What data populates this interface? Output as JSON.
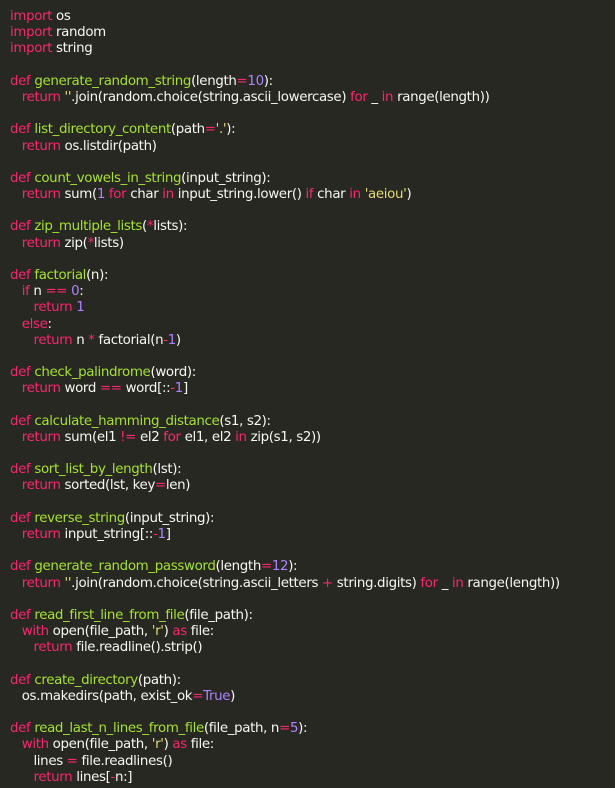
{
  "editor": {
    "lines": [
      [
        [
          "kw",
          "import"
        ],
        [
          "plain",
          " os"
        ]
      ],
      [
        [
          "kw",
          "import"
        ],
        [
          "plain",
          " random"
        ]
      ],
      [
        [
          "kw",
          "import"
        ],
        [
          "plain",
          " string"
        ]
      ],
      [],
      [
        [
          "kw",
          "def"
        ],
        [
          "plain",
          " "
        ],
        [
          "fn",
          "generate_random_string"
        ],
        [
          "plain",
          "(length"
        ],
        [
          "kw",
          "="
        ],
        [
          "num",
          "10"
        ],
        [
          "plain",
          "):"
        ]
      ],
      [
        [
          "plain",
          "   "
        ],
        [
          "kw",
          "return"
        ],
        [
          "plain",
          " "
        ],
        [
          "str",
          "''"
        ],
        [
          "plain",
          ".join(random.choice(string.ascii_lowercase) "
        ],
        [
          "kw",
          "for"
        ],
        [
          "plain",
          " _ "
        ],
        [
          "kw",
          "in"
        ],
        [
          "plain",
          " range(length))"
        ]
      ],
      [],
      [
        [
          "kw",
          "def"
        ],
        [
          "plain",
          " "
        ],
        [
          "fn",
          "list_directory_content"
        ],
        [
          "plain",
          "(path"
        ],
        [
          "kw",
          "="
        ],
        [
          "str",
          "'.'"
        ],
        [
          "plain",
          "):"
        ]
      ],
      [
        [
          "plain",
          "   "
        ],
        [
          "kw",
          "return"
        ],
        [
          "plain",
          " os.listdir(path)"
        ]
      ],
      [],
      [
        [
          "kw",
          "def"
        ],
        [
          "plain",
          " "
        ],
        [
          "fn",
          "count_vowels_in_string"
        ],
        [
          "plain",
          "(input_string):"
        ]
      ],
      [
        [
          "plain",
          "   "
        ],
        [
          "kw",
          "return"
        ],
        [
          "plain",
          " sum("
        ],
        [
          "num",
          "1"
        ],
        [
          "plain",
          " "
        ],
        [
          "kw",
          "for"
        ],
        [
          "plain",
          " char "
        ],
        [
          "kw",
          "in"
        ],
        [
          "plain",
          " input_string.lower() "
        ],
        [
          "kw",
          "if"
        ],
        [
          "plain",
          " char "
        ],
        [
          "kw",
          "in"
        ],
        [
          "plain",
          " "
        ],
        [
          "str",
          "'aeiou'"
        ],
        [
          "plain",
          ")"
        ]
      ],
      [],
      [
        [
          "kw",
          "def"
        ],
        [
          "plain",
          " "
        ],
        [
          "fn",
          "zip_multiple_lists"
        ],
        [
          "plain",
          "("
        ],
        [
          "kw",
          "*"
        ],
        [
          "plain",
          "lists):"
        ]
      ],
      [
        [
          "plain",
          "   "
        ],
        [
          "kw",
          "return"
        ],
        [
          "plain",
          " zip("
        ],
        [
          "kw",
          "*"
        ],
        [
          "plain",
          "lists)"
        ]
      ],
      [],
      [
        [
          "kw",
          "def"
        ],
        [
          "plain",
          " "
        ],
        [
          "fn",
          "factorial"
        ],
        [
          "plain",
          "(n):"
        ]
      ],
      [
        [
          "plain",
          "   "
        ],
        [
          "kw",
          "if"
        ],
        [
          "plain",
          " n "
        ],
        [
          "kw",
          "=="
        ],
        [
          "plain",
          " "
        ],
        [
          "num",
          "0"
        ],
        [
          "plain",
          ":"
        ]
      ],
      [
        [
          "plain",
          "      "
        ],
        [
          "kw",
          "return"
        ],
        [
          "plain",
          " "
        ],
        [
          "num",
          "1"
        ]
      ],
      [
        [
          "plain",
          "   "
        ],
        [
          "kw",
          "else"
        ],
        [
          "plain",
          ":"
        ]
      ],
      [
        [
          "plain",
          "      "
        ],
        [
          "kw",
          "return"
        ],
        [
          "plain",
          " n "
        ],
        [
          "kw",
          "*"
        ],
        [
          "plain",
          " factorial(n"
        ],
        [
          "kw",
          "-"
        ],
        [
          "num",
          "1"
        ],
        [
          "plain",
          ")"
        ]
      ],
      [],
      [
        [
          "kw",
          "def"
        ],
        [
          "plain",
          " "
        ],
        [
          "fn",
          "check_palindrome"
        ],
        [
          "plain",
          "(word):"
        ]
      ],
      [
        [
          "plain",
          "   "
        ],
        [
          "kw",
          "return"
        ],
        [
          "plain",
          " word "
        ],
        [
          "kw",
          "=="
        ],
        [
          "plain",
          " word[::"
        ],
        [
          "kw",
          "-"
        ],
        [
          "num",
          "1"
        ],
        [
          "plain",
          "]"
        ]
      ],
      [],
      [
        [
          "kw",
          "def"
        ],
        [
          "plain",
          " "
        ],
        [
          "fn",
          "calculate_hamming_distance"
        ],
        [
          "plain",
          "(s1, s2):"
        ]
      ],
      [
        [
          "plain",
          "   "
        ],
        [
          "kw",
          "return"
        ],
        [
          "plain",
          " sum(el1 "
        ],
        [
          "kw",
          "!="
        ],
        [
          "plain",
          " el2 "
        ],
        [
          "kw",
          "for"
        ],
        [
          "plain",
          " el1, el2 "
        ],
        [
          "kw",
          "in"
        ],
        [
          "plain",
          " zip(s1, s2))"
        ]
      ],
      [],
      [
        [
          "kw",
          "def"
        ],
        [
          "plain",
          " "
        ],
        [
          "fn",
          "sort_list_by_length"
        ],
        [
          "plain",
          "(lst):"
        ]
      ],
      [
        [
          "plain",
          "   "
        ],
        [
          "kw",
          "return"
        ],
        [
          "plain",
          " sorted(lst, key"
        ],
        [
          "kw",
          "="
        ],
        [
          "plain",
          "len)"
        ]
      ],
      [],
      [
        [
          "kw",
          "def"
        ],
        [
          "plain",
          " "
        ],
        [
          "fn",
          "reverse_string"
        ],
        [
          "plain",
          "(input_string):"
        ]
      ],
      [
        [
          "plain",
          "   "
        ],
        [
          "kw",
          "return"
        ],
        [
          "plain",
          " input_string[::"
        ],
        [
          "kw",
          "-"
        ],
        [
          "num",
          "1"
        ],
        [
          "plain",
          "]"
        ]
      ],
      [],
      [
        [
          "kw",
          "def"
        ],
        [
          "plain",
          " "
        ],
        [
          "fn",
          "generate_random_password"
        ],
        [
          "plain",
          "(length"
        ],
        [
          "kw",
          "="
        ],
        [
          "num",
          "12"
        ],
        [
          "plain",
          "):"
        ]
      ],
      [
        [
          "plain",
          "   "
        ],
        [
          "kw",
          "return"
        ],
        [
          "plain",
          " "
        ],
        [
          "str",
          "''"
        ],
        [
          "plain",
          ".join(random.choice(string.ascii_letters "
        ],
        [
          "kw",
          "+"
        ],
        [
          "plain",
          " string.digits) "
        ],
        [
          "kw",
          "for"
        ],
        [
          "plain",
          " _ "
        ],
        [
          "kw",
          "in"
        ],
        [
          "plain",
          " range(length))"
        ]
      ],
      [],
      [
        [
          "kw",
          "def"
        ],
        [
          "plain",
          " "
        ],
        [
          "fn",
          "read_first_line_from_file"
        ],
        [
          "plain",
          "(file_path):"
        ]
      ],
      [
        [
          "plain",
          "   "
        ],
        [
          "kw",
          "with"
        ],
        [
          "plain",
          " open(file_path, "
        ],
        [
          "str",
          "'r'"
        ],
        [
          "plain",
          ") "
        ],
        [
          "kw",
          "as"
        ],
        [
          "plain",
          " file:"
        ]
      ],
      [
        [
          "plain",
          "      "
        ],
        [
          "kw",
          "return"
        ],
        [
          "plain",
          " file.readline().strip()"
        ]
      ],
      [],
      [
        [
          "kw",
          "def"
        ],
        [
          "plain",
          " "
        ],
        [
          "fn",
          "create_directory"
        ],
        [
          "plain",
          "(path):"
        ]
      ],
      [
        [
          "plain",
          "   os.makedirs(path, exist_ok"
        ],
        [
          "kw",
          "="
        ],
        [
          "const",
          "True"
        ],
        [
          "plain",
          ")"
        ]
      ],
      [],
      [
        [
          "kw",
          "def"
        ],
        [
          "plain",
          " "
        ],
        [
          "fn",
          "read_last_n_lines_from_file"
        ],
        [
          "plain",
          "(file_path, n"
        ],
        [
          "kw",
          "="
        ],
        [
          "num",
          "5"
        ],
        [
          "plain",
          "):"
        ]
      ],
      [
        [
          "plain",
          "   "
        ],
        [
          "kw",
          "with"
        ],
        [
          "plain",
          " open(file_path, "
        ],
        [
          "str",
          "'r'"
        ],
        [
          "plain",
          ") "
        ],
        [
          "kw",
          "as"
        ],
        [
          "plain",
          " file:"
        ]
      ],
      [
        [
          "plain",
          "      lines "
        ],
        [
          "kw",
          "="
        ],
        [
          "plain",
          " file.readlines()"
        ]
      ],
      [
        [
          "plain",
          "      "
        ],
        [
          "kw",
          "return"
        ],
        [
          "plain",
          " lines["
        ],
        [
          "kw",
          "-"
        ],
        [
          "plain",
          "n:]"
        ]
      ]
    ]
  },
  "colors": {
    "background": "#272822",
    "text": "#f8f8f2",
    "keyword": "#f92672",
    "function_name": "#a6e22e",
    "number": "#ae81ff",
    "string": "#e6db74"
  }
}
